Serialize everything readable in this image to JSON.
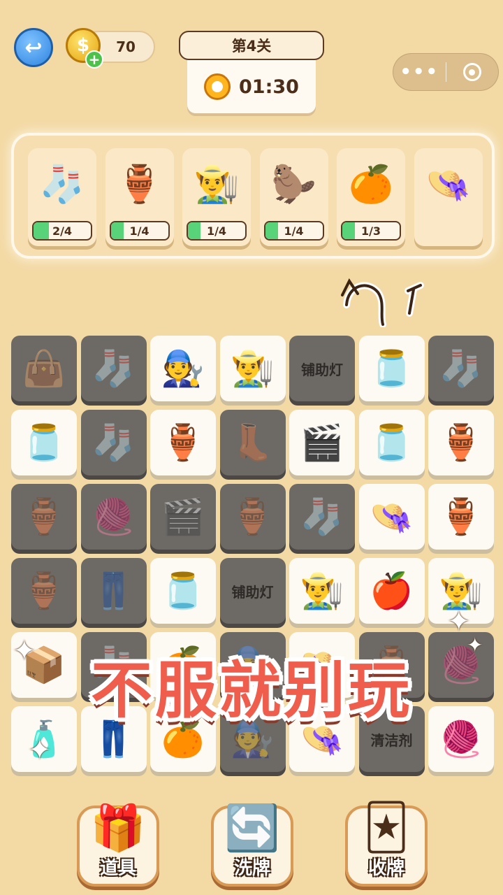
{
  "header": {
    "coins": "70",
    "level": "第4关",
    "timer": "01:30",
    "menu_dots": "•••"
  },
  "tray": {
    "slots": [
      {
        "icon": "🧦",
        "name": "socks",
        "progress": "2/4",
        "fraction": 0.5
      },
      {
        "icon": "🏺",
        "name": "porcelain-vase",
        "progress": "1/4",
        "fraction": 0.25
      },
      {
        "icon": "👨‍🌾",
        "name": "farmer",
        "progress": "1/4",
        "fraction": 0.25
      },
      {
        "icon": "🦫",
        "name": "capybara-bath",
        "progress": "1/4",
        "fraction": 0.25
      },
      {
        "icon": "🍊",
        "name": "orange-crate",
        "progress": "1/3",
        "fraction": 0.33
      },
      {
        "icon": "👒",
        "name": "straw-hat",
        "progress": "",
        "fraction": 0
      }
    ]
  },
  "board": {
    "rows": [
      [
        {
          "icon": "👜",
          "dark": true
        },
        {
          "icon": "🧦",
          "dark": true
        },
        {
          "icon": "🧑‍🔧",
          "dark": false
        },
        {
          "icon": "👨‍🌾",
          "dark": false
        },
        {
          "text": "铺助灯",
          "dark": true
        },
        {
          "icon": "🫙",
          "dark": false
        },
        {
          "icon": "🧦",
          "dark": true
        }
      ],
      [
        {
          "icon": "🫙",
          "dark": false
        },
        {
          "icon": "🧦",
          "dark": true
        },
        {
          "icon": "🏺",
          "dark": false
        },
        {
          "icon": "👢",
          "dark": true
        },
        {
          "icon": "🎬",
          "dark": false
        },
        {
          "icon": "🫙",
          "dark": false
        },
        {
          "icon": "🏺",
          "dark": false
        }
      ],
      [
        {
          "icon": "🏺",
          "dark": true
        },
        {
          "icon": "🧶",
          "dark": true
        },
        {
          "icon": "🎬",
          "dark": true
        },
        {
          "icon": "🏺",
          "dark": true
        },
        {
          "icon": "🧦",
          "dark": true
        },
        {
          "icon": "👒",
          "dark": false
        },
        {
          "icon": "🏺",
          "dark": false
        }
      ],
      [
        {
          "icon": "🏺",
          "dark": true
        },
        {
          "icon": "👖",
          "dark": true
        },
        {
          "icon": "🫙",
          "dark": false
        },
        {
          "text": "铺助灯",
          "dark": true
        },
        {
          "icon": "👨‍🌾",
          "dark": false
        },
        {
          "icon": "🍎",
          "dark": false
        },
        {
          "icon": "👨‍🌾",
          "dark": false
        }
      ],
      [
        {
          "icon": "📦",
          "dark": false
        },
        {
          "icon": "🧦",
          "dark": true
        },
        {
          "icon": "🍊",
          "dark": false
        },
        {
          "icon": "🧑‍🔧",
          "dark": true
        },
        {
          "icon": "👒",
          "dark": false
        },
        {
          "icon": "🏺",
          "dark": true
        },
        {
          "icon": "🧶",
          "dark": true
        }
      ],
      [
        {
          "icon": "🧴",
          "dark": false
        },
        {
          "icon": "👖",
          "dark": false
        },
        {
          "icon": "🍊",
          "dark": false
        },
        {
          "icon": "🧑‍🔧",
          "dark": true
        },
        {
          "icon": "👒",
          "dark": false
        },
        {
          "text": "清洁剂",
          "dark": true
        },
        {
          "icon": "🧶",
          "dark": false
        }
      ]
    ]
  },
  "slogan": "不服就别玩",
  "tools": [
    {
      "icon": "🎁",
      "label": "道具",
      "name": "props-tool-button"
    },
    {
      "icon": "🔄",
      "label": "洗牌",
      "name": "shuffle-tool-button"
    },
    {
      "icon": "🃏",
      "label": "收牌",
      "name": "collect-cards-tool-button"
    }
  ],
  "colors": {
    "background": "#f3d9a4",
    "progress_fill": "#58d37a",
    "slogan": "#ef5d4c"
  }
}
